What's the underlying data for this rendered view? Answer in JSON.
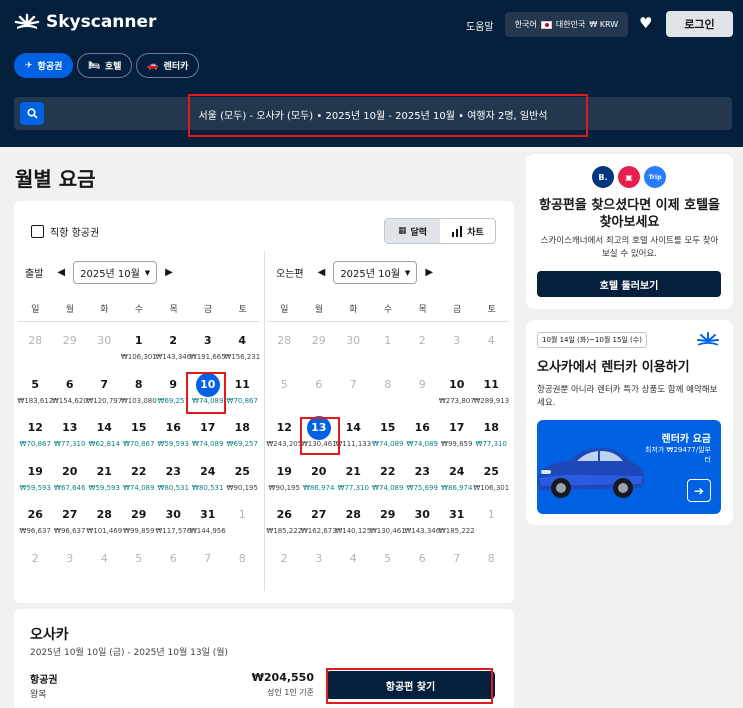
{
  "header": {
    "brand": "Skyscanner",
    "help": "도움말",
    "locale": "한국어",
    "region": "대한민국",
    "currency": "₩ KRW",
    "login": "로그인"
  },
  "tabs": [
    {
      "label": "항공권",
      "icon": "plane-icon",
      "active": true
    },
    {
      "label": "호텔",
      "icon": "bed-icon",
      "active": false
    },
    {
      "label": "렌터카",
      "icon": "car-icon",
      "active": false
    }
  ],
  "search": {
    "summary": "서울 (모두) - 오사카 (모두)  •  2025년 10월 - 2025년 10월  •  여행자 2명, 일반석"
  },
  "page_title": "월별 요금",
  "calendar": {
    "direct_label": "직항 항공권",
    "view_calendar": "달력",
    "view_chart": "차트",
    "weekdays": [
      "일",
      "월",
      "화",
      "수",
      "목",
      "금",
      "토"
    ],
    "depart": {
      "label": "출발",
      "month": "2025년 10월",
      "days": [
        {
          "d": "28",
          "p": "",
          "m": 1
        },
        {
          "d": "29",
          "p": "",
          "m": 1
        },
        {
          "d": "30",
          "p": "",
          "m": 1
        },
        {
          "d": "1",
          "p": "₩106,301"
        },
        {
          "d": "2",
          "p": "₩143,346"
        },
        {
          "d": "3",
          "p": "₩191,665"
        },
        {
          "d": "4",
          "p": "₩156,231"
        },
        {
          "d": "5",
          "p": "₩183,612"
        },
        {
          "d": "6",
          "p": "₩154,620"
        },
        {
          "d": "7",
          "p": "₩120,797"
        },
        {
          "d": "8",
          "p": "₩103,080"
        },
        {
          "d": "9",
          "p": "₩69,257",
          "g": 1
        },
        {
          "d": "10",
          "p": "₩74,089",
          "g": 1,
          "sel": 1
        },
        {
          "d": "11",
          "p": "₩70,867",
          "g": 1
        },
        {
          "d": "12",
          "p": "₩70,867",
          "g": 1
        },
        {
          "d": "13",
          "p": "₩77,310",
          "g": 1
        },
        {
          "d": "14",
          "p": "₩62,814",
          "g": 1
        },
        {
          "d": "15",
          "p": "₩70,867",
          "g": 1
        },
        {
          "d": "16",
          "p": "₩59,593",
          "g": 1
        },
        {
          "d": "17",
          "p": "₩74,089",
          "g": 1
        },
        {
          "d": "18",
          "p": "₩69,257",
          "g": 1
        },
        {
          "d": "19",
          "p": "₩59,593",
          "g": 1
        },
        {
          "d": "20",
          "p": "₩67,646",
          "g": 1
        },
        {
          "d": "21",
          "p": "₩59,593",
          "g": 1
        },
        {
          "d": "22",
          "p": "₩74,089",
          "g": 1
        },
        {
          "d": "23",
          "p": "₩80,531",
          "g": 1
        },
        {
          "d": "24",
          "p": "₩80,531",
          "g": 1
        },
        {
          "d": "25",
          "p": "₩90,195"
        },
        {
          "d": "26",
          "p": "₩96,637"
        },
        {
          "d": "27",
          "p": "₩96,637"
        },
        {
          "d": "28",
          "p": "₩101,469"
        },
        {
          "d": "29",
          "p": "₩99,859"
        },
        {
          "d": "30",
          "p": "₩117,576"
        },
        {
          "d": "31",
          "p": "₩144,956"
        },
        {
          "d": "1",
          "p": "",
          "m": 1
        },
        {
          "d": "2",
          "p": "",
          "m": 1
        },
        {
          "d": "3",
          "p": "",
          "m": 1
        },
        {
          "d": "4",
          "p": "",
          "m": 1
        },
        {
          "d": "5",
          "p": "",
          "m": 1
        },
        {
          "d": "6",
          "p": "",
          "m": 1
        },
        {
          "d": "7",
          "p": "",
          "m": 1
        },
        {
          "d": "8",
          "p": "",
          "m": 1
        }
      ]
    },
    "return": {
      "label": "오는편",
      "month": "2025년 10월",
      "days": [
        {
          "d": "28",
          "p": "",
          "m": 1
        },
        {
          "d": "29",
          "p": "",
          "m": 1
        },
        {
          "d": "30",
          "p": "",
          "m": 1
        },
        {
          "d": "1",
          "p": "",
          "pa": 1
        },
        {
          "d": "2",
          "p": "",
          "pa": 1
        },
        {
          "d": "3",
          "p": "",
          "pa": 1
        },
        {
          "d": "4",
          "p": "",
          "pa": 1
        },
        {
          "d": "5",
          "p": "",
          "pa": 1
        },
        {
          "d": "6",
          "p": "",
          "pa": 1
        },
        {
          "d": "7",
          "p": "",
          "pa": 1
        },
        {
          "d": "8",
          "p": "",
          "pa": 1
        },
        {
          "d": "9",
          "p": "",
          "pa": 1
        },
        {
          "d": "10",
          "p": "₩273,807"
        },
        {
          "d": "11",
          "p": "₩289,913"
        },
        {
          "d": "12",
          "p": "₩243,205"
        },
        {
          "d": "13",
          "p": "₩130,461",
          "sel": 1
        },
        {
          "d": "14",
          "p": "₩111,133"
        },
        {
          "d": "15",
          "p": "₩74,089",
          "g": 1
        },
        {
          "d": "16",
          "p": "₩74,089",
          "g": 1
        },
        {
          "d": "17",
          "p": "₩99,859"
        },
        {
          "d": "18",
          "p": "₩77,310",
          "g": 1
        },
        {
          "d": "19",
          "p": "₩90,195"
        },
        {
          "d": "20",
          "p": "₩86,974",
          "g": 1
        },
        {
          "d": "21",
          "p": "₩77,310",
          "g": 1
        },
        {
          "d": "22",
          "p": "₩74,089",
          "g": 1
        },
        {
          "d": "23",
          "p": "₩75,699",
          "g": 1
        },
        {
          "d": "24",
          "p": "₩86,974",
          "g": 1
        },
        {
          "d": "25",
          "p": "₩106,301"
        },
        {
          "d": "26",
          "p": "₩185,222"
        },
        {
          "d": "27",
          "p": "₩162,673"
        },
        {
          "d": "28",
          "p": "₩140,125"
        },
        {
          "d": "29",
          "p": "₩130,461"
        },
        {
          "d": "30",
          "p": "₩143,346"
        },
        {
          "d": "31",
          "p": "₩185,222"
        },
        {
          "d": "1",
          "p": "",
          "m": 1
        },
        {
          "d": "2",
          "p": "",
          "m": 1
        },
        {
          "d": "3",
          "p": "",
          "m": 1
        },
        {
          "d": "4",
          "p": "",
          "m": 1
        },
        {
          "d": "5",
          "p": "",
          "m": 1
        },
        {
          "d": "6",
          "p": "",
          "m": 1
        },
        {
          "d": "7",
          "p": "",
          "m": 1
        },
        {
          "d": "8",
          "p": "",
          "m": 1
        }
      ]
    }
  },
  "summary": {
    "city": "오사카",
    "dates": "2025년 10월 10일 (금) - 2025년 10월 13일 (월)",
    "flight_label": "항공권",
    "trip_type": "왕복",
    "price": "₩204,550",
    "per": "성인 1인 기준",
    "cta": "항공편 찾기"
  },
  "hotel_card": {
    "logos": [
      {
        "text": "B.",
        "color": "#003580"
      },
      {
        "text": "",
        "color": "#ff385c"
      },
      {
        "text": "Trip",
        "color": "#287dfa"
      }
    ],
    "title": "항공편을 찾으셨다면 이제 호텔을 찾아보세요",
    "desc": "스카이스캐너에서 최고의 호텔 사이트를 모두 찾아보실 수 있어요.",
    "cta": "호텔 둘러보기"
  },
  "car_card": {
    "badge": "10월 14일 (화)~10월 15일 (수)",
    "title": "오사카에서 렌터카 이용하기",
    "desc": "항공권뿐 아니라 렌터카 특가 상품도 함께 예약해보세요.",
    "promo_title": "렌터카 요금",
    "promo_sub": "최저가 ₩29477/일부터",
    "colors": {
      "brand_dark": "#05203c",
      "accent": "#0062e3",
      "green_price": "#0c838a",
      "highlight": "#e01b1b"
    }
  }
}
